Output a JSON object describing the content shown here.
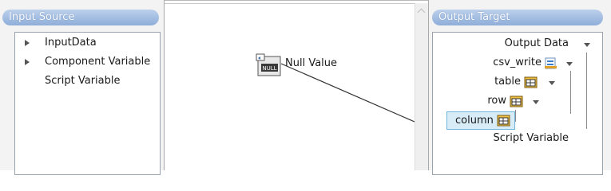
{
  "input_panel": {
    "title": "Input Source",
    "items": [
      {
        "label": "InputData",
        "expandable": true
      },
      {
        "label": "Component Variable",
        "expandable": true
      },
      {
        "label": "Script Variable",
        "expandable": false
      }
    ]
  },
  "canvas": {
    "node": {
      "label": "Null Value",
      "icon": "null-value-icon",
      "icon_text": "NULL"
    }
  },
  "output_panel": {
    "title": "Output Target",
    "items": [
      {
        "label": "Output Data"
      },
      {
        "label": "csv_write",
        "icon": "csv-file-icon"
      },
      {
        "label": "table",
        "icon": "table-icon"
      },
      {
        "label": "row",
        "icon": "row-icon"
      },
      {
        "label": "column",
        "icon": "column-icon",
        "selected": true
      },
      {
        "label": "Script Variable"
      }
    ]
  },
  "colors": {
    "header_gradient_top": "#bcd0ec",
    "header_gradient_bottom": "#8eaed9",
    "selected_bg": "#d8ecf8",
    "selected_border": "#6fb6dc",
    "panel_bg": "#f3f3f3"
  }
}
